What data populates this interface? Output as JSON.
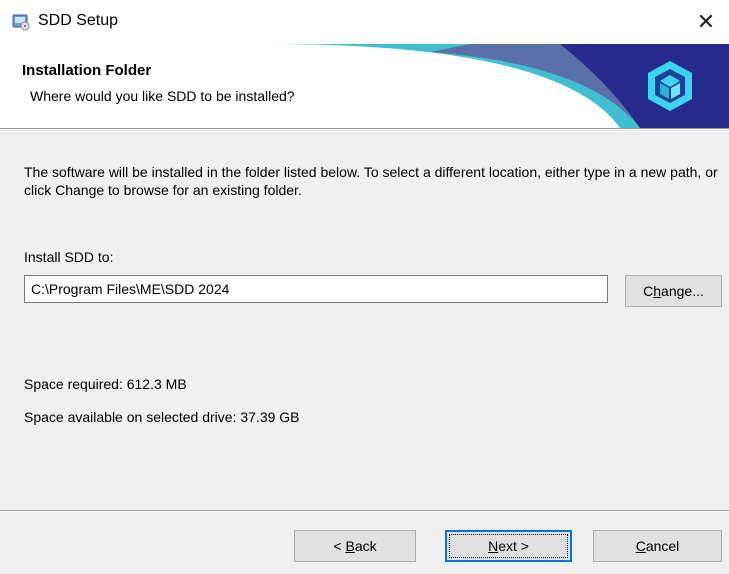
{
  "window": {
    "title": "SDD Setup",
    "close_glyph": "✕"
  },
  "header": {
    "title": "Installation Folder",
    "subtitle": "Where would you like SDD to be installed?"
  },
  "body": {
    "description": "The software will be installed in the folder listed below. To select a different location, either type in a new path, or click Change to browse for an existing folder.",
    "install_label": "Install SDD to:",
    "install_path": "C:\\Program Files\\ME\\SDD 2024",
    "change_button": {
      "pre": "C",
      "key": "h",
      "post": "ange..."
    },
    "space_required": "Space required: 612.3 MB",
    "space_available": "Space available on selected drive: 37.39 GB"
  },
  "footer": {
    "back_button": {
      "pre": "< ",
      "key": "B",
      "post": "ack"
    },
    "next_button": {
      "pre": "",
      "key": "N",
      "post": "ext >"
    },
    "cancel_button": {
      "pre": "",
      "key": "C",
      "post": "ancel"
    }
  },
  "icons": {
    "app": "installer-icon",
    "logo": "cube-logo-icon",
    "close": "close-icon"
  },
  "colors": {
    "banner_teal": "#3fbfcf",
    "banner_slate": "#5b6fa8",
    "banner_navy": "#262a8a",
    "logo_cyan": "#3ad6f0",
    "focus_blue": "#0078d7"
  }
}
